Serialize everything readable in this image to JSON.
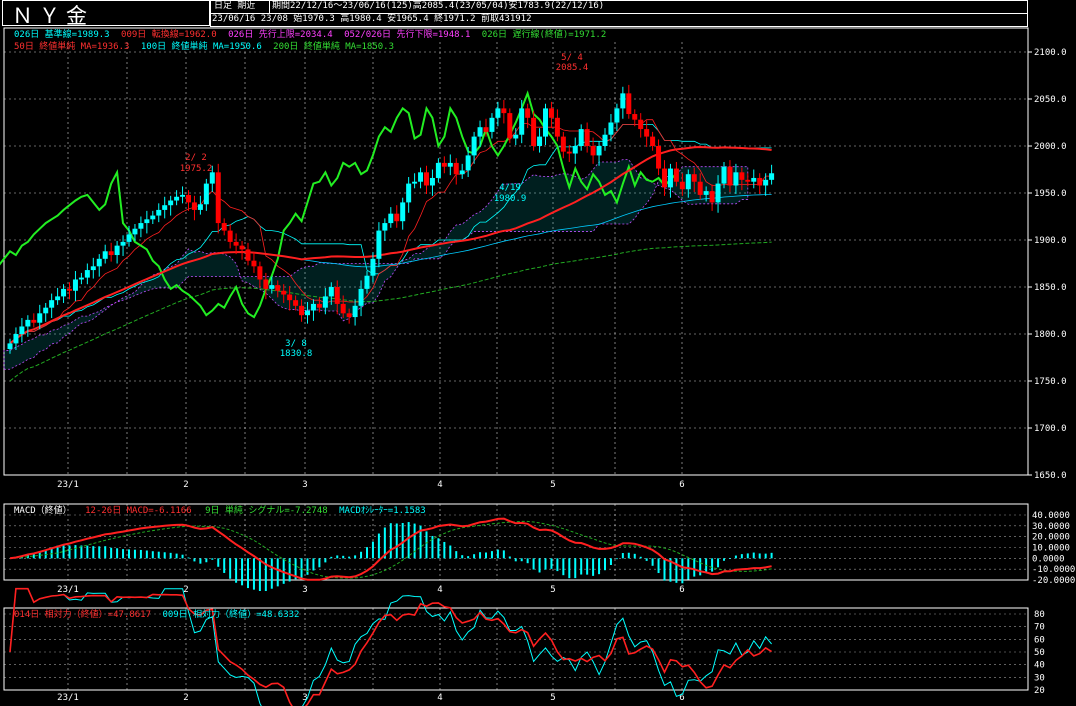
{
  "header": {
    "title": "ＮＹ金",
    "period_type": "日足 期近",
    "range_info": "期間22/12/16～23/06/16(125)高2085.4(23/05/04)安1783.9(22/12/16)",
    "last_bar": "23/06/16 23/08 始1970.3 高1980.4 安1965.4 終1971.2 前取431912"
  },
  "main_legend": {
    "line1": [
      {
        "text": "026日 基準線=1989.3",
        "color": "#00ffff"
      },
      {
        "text": "009日 転換線=1962.0",
        "color": "#ff3030"
      },
      {
        "text": "026日 先行上限=2034.4",
        "color": "#ff40ff"
      },
      {
        "text": "052/026日 先行下限=1948.1",
        "color": "#ff40ff"
      },
      {
        "text": "026日 遅行線(終値)=1971.2",
        "color": "#33dd33"
      }
    ],
    "line2": [
      {
        "text": "50日 終値単純 MA=1936.3",
        "color": "#ff3030"
      },
      {
        "text": "100日 終値単純 MA=1950.6",
        "color": "#00ffff"
      },
      {
        "text": "200日 終値単純 MA=1850.3",
        "color": "#33dd33"
      }
    ]
  },
  "annotations": [
    {
      "text": "5/ 4",
      "color": "#ff3030"
    },
    {
      "text": "2085.4",
      "color": "#ff3030"
    },
    {
      "text": "2/ 2",
      "color": "#ff3030"
    },
    {
      "text": "1975.2",
      "color": "#ff3030"
    },
    {
      "text": "4/19",
      "color": "#00ffff"
    },
    {
      "text": "1980.9",
      "color": "#00ffff"
    },
    {
      "text": "3/ 8",
      "color": "#00ffff"
    },
    {
      "text": "1830.8",
      "color": "#00ffff"
    }
  ],
  "macd_legend": [
    {
      "text": "MACD（終値）",
      "color": "#ffffff"
    },
    {
      "text": "12-26日 MACD=-6.1166",
      "color": "#ff3030"
    },
    {
      "text": "9日 単純 シグナル=-7.2748",
      "color": "#33dd33"
    },
    {
      "text": "MACDｵｼﾚｰﾀｰ=1.1583",
      "color": "#00ffff"
    }
  ],
  "rsi_legend": [
    {
      "text": "014日 相対力（終値）=47.8617",
      "color": "#ff3030"
    },
    {
      "text": "009日 相対力（終値）=48.6332",
      "color": "#00ffff"
    }
  ],
  "colors": {
    "up": "#00ffff",
    "down": "#ff0000",
    "grid": "#ffffff",
    "ma50": "#ff2020",
    "ma100": "#00ccff",
    "ma200": "#22aa22",
    "kijun": "#00ffff",
    "tenkan": "#ff2020",
    "chikou": "#22ee22",
    "cloud": "#cc44ff"
  },
  "chart_data": {
    "type": "candlestick",
    "title": "ＮＹ金",
    "x_month_labels": [
      "23/1",
      "2",
      "3",
      "4",
      "5",
      "6"
    ],
    "main_y_ticks": [
      "2100.0",
      "2050.0",
      "2000.0",
      "1950.0",
      "1900.0",
      "1850.0",
      "1800.0",
      "1750.0",
      "1700.0",
      "1650.0"
    ],
    "main_ylim": [
      1650,
      2100
    ],
    "macd_y_ticks": [
      "40.0000",
      "30.0000",
      "20.0000",
      "10.0000",
      "0.0000",
      "-10.0000",
      "-20.0000"
    ],
    "macd_ylim": [
      -20,
      40
    ],
    "rsi_y_ticks": [
      "80",
      "70",
      "60",
      "50",
      "40",
      "30",
      "20"
    ],
    "rsi_ylim": [
      20,
      80
    ],
    "close": [
      1790,
      1800,
      1808,
      1815,
      1812,
      1822,
      1828,
      1836,
      1840,
      1848,
      1846,
      1858,
      1860,
      1868,
      1872,
      1880,
      1888,
      1884,
      1894,
      1898,
      1906,
      1912,
      1918,
      1922,
      1926,
      1932,
      1937,
      1942,
      1946,
      1948,
      1940,
      1932,
      1938,
      1960,
      1972,
      1918,
      1910,
      1898,
      1894,
      1890,
      1878,
      1872,
      1858,
      1848,
      1852,
      1846,
      1842,
      1836,
      1830,
      1820,
      1825,
      1832,
      1828,
      1840,
      1850,
      1832,
      1822,
      1818,
      1830,
      1848,
      1862,
      1880,
      1910,
      1918,
      1928,
      1920,
      1940,
      1960,
      1962,
      1972,
      1958,
      1966,
      1982,
      1978,
      1982,
      1970,
      1974,
      1990,
      2010,
      2020,
      2015,
      2030,
      2040,
      2035,
      2008,
      2012,
      2040,
      2030,
      2000,
      2010,
      2040,
      2030,
      2010,
      1994,
      1992,
      2000,
      2018,
      2000,
      1990,
      2000,
      2012,
      2025,
      2040,
      2056,
      2034,
      2028,
      2018,
      2010,
      2000,
      1976,
      1956,
      1976,
      1962,
      1954,
      1970,
      1962,
      1948,
      1952,
      1940,
      1960,
      1978,
      1958,
      1972,
      1964,
      1962,
      1966,
      1958,
      1964,
      1971
    ]
  }
}
